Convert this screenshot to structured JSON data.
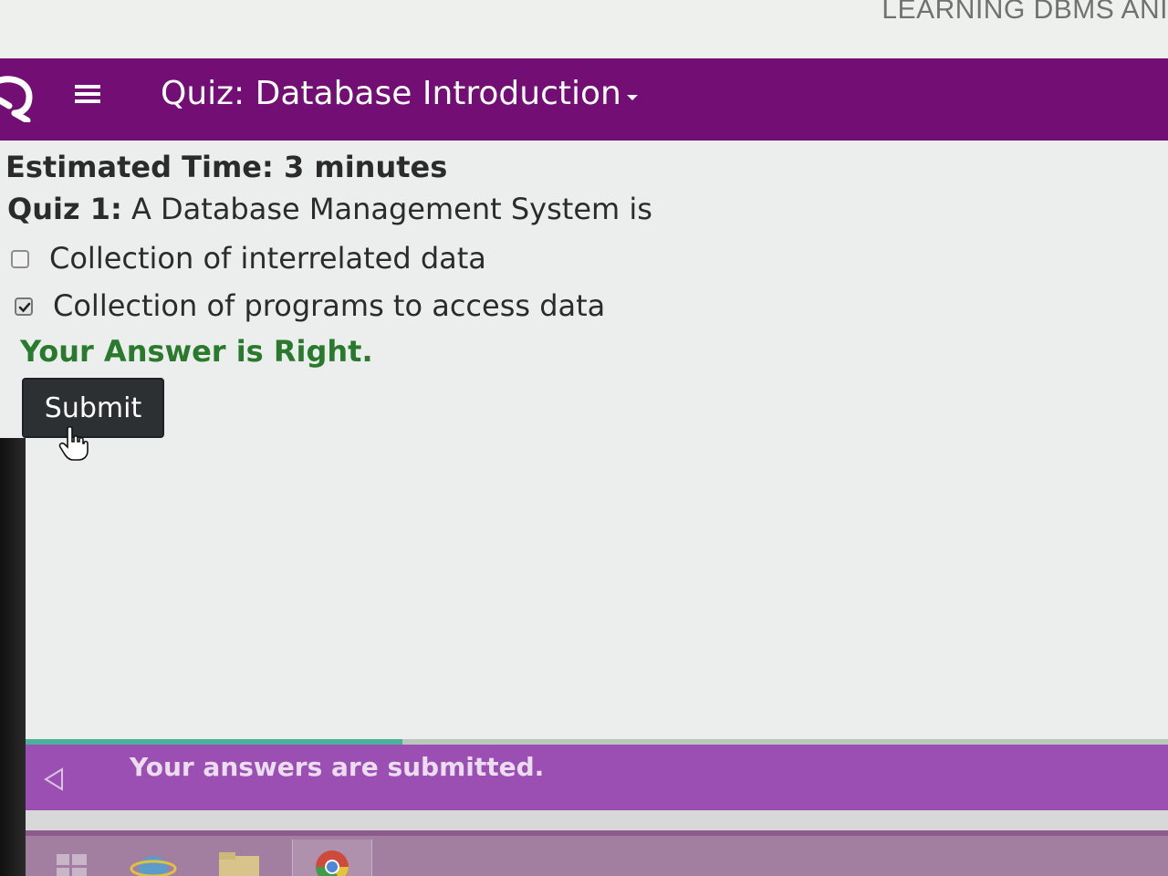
{
  "browser": {
    "window_title": "LEARNING DBMS ANI"
  },
  "header": {
    "title": "Quiz: Database Introduction"
  },
  "quiz": {
    "estimated_time": "Estimated Time: 3 minutes",
    "question_number": "Quiz 1:",
    "question_text": "A Database Management System is",
    "options": [
      {
        "label": "Collection of interrelated data",
        "checked": false
      },
      {
        "label": "Collection of programs to access data",
        "checked": true
      }
    ],
    "result": "Your Answer is Right.",
    "submit_label": "Submit"
  },
  "progress": {
    "fraction": 0.33
  },
  "notice": {
    "text": "Your answers are submitted."
  },
  "colors": {
    "header_bg": "#720e74",
    "notice_bg": "#9c4fb2",
    "result_text": "#2a7a2d",
    "submit_bg": "#2c3033",
    "progress_fill": "#4ab09a"
  },
  "icons": {
    "logo": "app-logo-icon",
    "menu": "hamburger-menu-icon",
    "dropdown": "caret-down-icon",
    "cursor": "hand-pointer-icon",
    "back": "triangle-back-icon",
    "taskbar": [
      "windows-start-icon",
      "internet-explorer-icon",
      "file-explorer-icon",
      "chrome-icon"
    ]
  }
}
